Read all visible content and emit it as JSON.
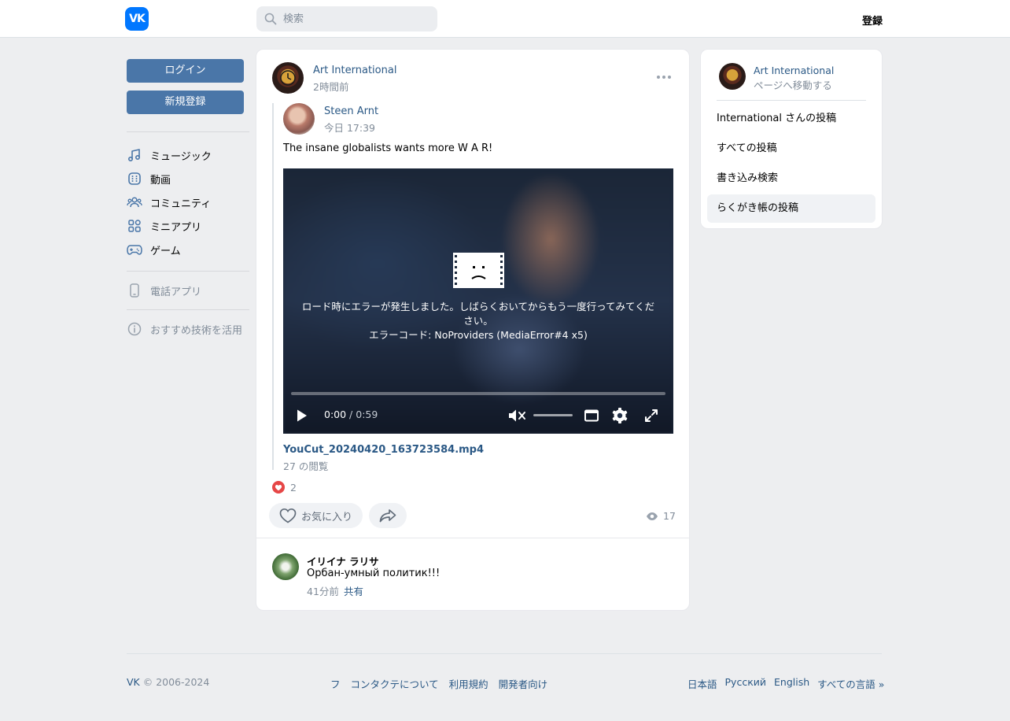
{
  "header": {
    "logo_text": "VK",
    "search_placeholder": "検索",
    "register_label": "登録"
  },
  "left": {
    "login_label": "ログイン",
    "signup_label": "新規登録",
    "nav": [
      {
        "label": "ミュージック",
        "icon": "music-icon"
      },
      {
        "label": "動画",
        "icon": "video-icon"
      },
      {
        "label": "コミュニティ",
        "icon": "community-icon"
      },
      {
        "label": "ミニアプリ",
        "icon": "mini-apps-icon"
      },
      {
        "label": "ゲーム",
        "icon": "gamepad-icon"
      }
    ],
    "phone_app_label": "電話アプリ",
    "recommend_label": "おすすめ技術を活用"
  },
  "post": {
    "author": "Art International",
    "time": "2時間前",
    "repost": {
      "author": "Steen Arnt",
      "time": "今日 17:39",
      "text": "The insane globalists wants more W A R!"
    },
    "video": {
      "error_line1": "ロード時にエラーが発生しました。しばらくおいてからもう一度行ってみてくだ",
      "error_line2": "さい。",
      "error_code": "エラーコード: NoProviders (MediaError#4 x5)",
      "time_current": "0:00",
      "time_sep": " / ",
      "time_total": "0:59",
      "progress": 0
    },
    "file_name": "YouCut_20240420_163723584.mp4",
    "file_views": "27 の閲覧",
    "likes": "2",
    "like_label": "お気に入り",
    "views": "17"
  },
  "comment": {
    "author": "イリイナ ラリサ",
    "text": "Орбан-умный политик!!!",
    "time": "41分前",
    "share_label": "共有"
  },
  "right": {
    "name": "Art International",
    "sub": "ページへ移動する",
    "items": [
      {
        "label": "International さんの投稿",
        "active": false
      },
      {
        "label": "すべての投稿",
        "active": false
      },
      {
        "label": "書き込み検索",
        "active": false
      },
      {
        "label": "らくがき帳の投稿",
        "active": true
      }
    ]
  },
  "footer": {
    "brand": "VK",
    "copyright": " © 2006-2024",
    "links": [
      "フ",
      "コンタクテについて",
      "利用規約",
      "開発者向け"
    ],
    "languages": [
      "日本語",
      "Русский",
      "English",
      "すべての言語 »"
    ]
  },
  "colors": {
    "accent": "#4a76a8",
    "link": "#2a5885",
    "vk_blue": "#0077ff",
    "background": "#edeef0",
    "heart": "#e64646"
  }
}
